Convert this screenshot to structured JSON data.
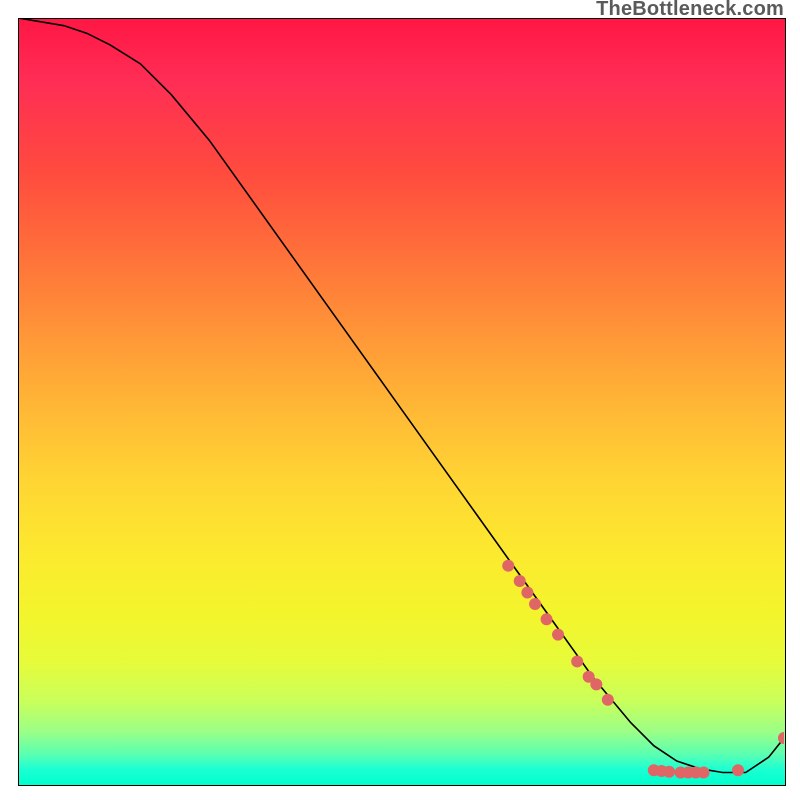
{
  "watermark": "TheBottleneck.com",
  "chart_data": {
    "type": "line",
    "title": "",
    "xlabel": "",
    "ylabel": "",
    "xlim": [
      0,
      100
    ],
    "ylim": [
      0,
      100
    ],
    "series": [
      {
        "name": "curve",
        "x": [
          0,
          3,
          6,
          9,
          12,
          16,
          20,
          25,
          30,
          35,
          40,
          45,
          50,
          55,
          60,
          65,
          70,
          75,
          80,
          83,
          86,
          89,
          92,
          95,
          98,
          100
        ],
        "y": [
          100,
          99.5,
          99,
          98,
          96.5,
          94,
          90,
          84,
          77,
          70,
          63,
          56,
          49,
          42,
          35,
          28,
          21,
          14,
          8,
          5,
          3,
          2,
          1.5,
          1.5,
          3.5,
          6
        ]
      }
    ],
    "markers": [
      {
        "x": 64,
        "y": 28.5
      },
      {
        "x": 65.5,
        "y": 26.5
      },
      {
        "x": 66.5,
        "y": 25
      },
      {
        "x": 67.5,
        "y": 23.5
      },
      {
        "x": 69,
        "y": 21.5
      },
      {
        "x": 70.5,
        "y": 19.5
      },
      {
        "x": 73,
        "y": 16
      },
      {
        "x": 74.5,
        "y": 14
      },
      {
        "x": 75.5,
        "y": 13
      },
      {
        "x": 77,
        "y": 11
      },
      {
        "x": 83,
        "y": 1.8
      },
      {
        "x": 84,
        "y": 1.7
      },
      {
        "x": 85,
        "y": 1.6
      },
      {
        "x": 86.5,
        "y": 1.5
      },
      {
        "x": 87.5,
        "y": 1.5
      },
      {
        "x": 88.5,
        "y": 1.5
      },
      {
        "x": 89.5,
        "y": 1.5
      },
      {
        "x": 94,
        "y": 1.8
      },
      {
        "x": 100,
        "y": 6
      }
    ],
    "marker_color": "#e06666",
    "line_color": "#000000"
  }
}
